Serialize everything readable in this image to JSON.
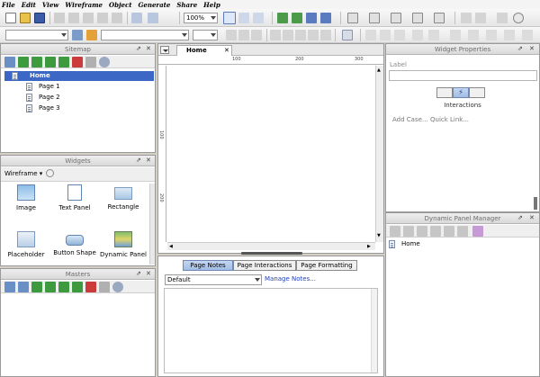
{
  "menu": [
    "File",
    "Edit",
    "View",
    "Wireframe",
    "Object",
    "Generate",
    "Share",
    "Help"
  ],
  "toolbar": {
    "zoom": "100%"
  },
  "sitemap": {
    "title": "Sitemap",
    "root": "Home",
    "pages": [
      "Page 1",
      "Page 2",
      "Page 3"
    ]
  },
  "widgets": {
    "title": "Widgets",
    "library": "Wireframe",
    "items": [
      "Image",
      "Text Panel",
      "Rectangle",
      "Placeholder",
      "Button Shape",
      "Dynamic Panel"
    ]
  },
  "masters": {
    "title": "Masters"
  },
  "canvas": {
    "tab": "Home",
    "ruler_labels": [
      "100",
      "200",
      "300"
    ],
    "vruler_labels": [
      "100",
      "200"
    ]
  },
  "page_notes": {
    "tabs": [
      "Page Notes",
      "Page Interactions",
      "Page Formatting"
    ],
    "notes_select": "Default",
    "manage_link": "Manage Notes..."
  },
  "widget_properties": {
    "title": "Widget Properties",
    "label": "Label",
    "section": "Interactions",
    "add_case": "Add Case...",
    "quick_link": "Quick Link..."
  },
  "dynamic_panel_manager": {
    "title": "Dynamic Panel Manager",
    "root": "Home"
  }
}
